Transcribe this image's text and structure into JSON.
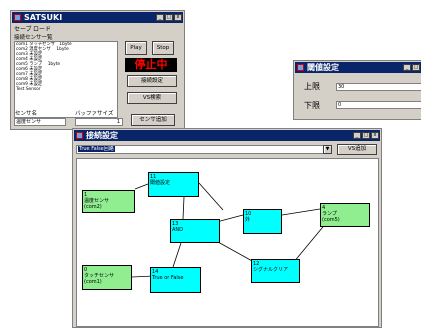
{
  "main_window": {
    "title": "SATSUKI",
    "menu": [
      "セーブ",
      "ロード"
    ],
    "list_label": "接続センサ一覧",
    "sensors": [
      "com1  タッチセンサ　1byte",
      "com2  温度センサ　 1byte",
      "com3       未設定",
      "com4       未設定",
      "com5  ランプ　 1byte",
      "com6       未設定",
      "com7       未設定",
      "com8       未設定",
      "com9       未設定",
      "        Test Sensor"
    ],
    "play_label": "Play",
    "stop_label": "Stop",
    "status_text": "停止中",
    "connect_settings_label": "接続設定",
    "vs_monitor_label": "VS検索",
    "sensor_name_label": "センサ名",
    "buffer_size_label": "バッファサイズ",
    "sensor_name_value": "温度センサ",
    "buffer_size_value": "1",
    "add_sensor_label": "センサ追加"
  },
  "threshold_window": {
    "title": "閾値設定",
    "upper_label": "上限",
    "upper_value": "30",
    "lower_label": "下限",
    "lower_value": "0"
  },
  "connection_window": {
    "title": "接続設定",
    "dropdown_value": "True False回路",
    "add_vs_label": "VS追加",
    "nodes": [
      {
        "id": "n1",
        "number": "1",
        "label": "温度センサ",
        "sub": "(com2)",
        "color": "#90ee90"
      },
      {
        "id": "n11",
        "number": "11",
        "label": "閾値設定",
        "sub": "",
        "color": "#00ffff"
      },
      {
        "id": "n13",
        "number": "13",
        "label": "AND",
        "sub": "",
        "color": "#00ffff"
      },
      {
        "id": "n10",
        "number": "10",
        "label": "外",
        "sub": "",
        "color": "#00ffff"
      },
      {
        "id": "n4",
        "number": "4",
        "label": "ランプ",
        "sub": "(com5)",
        "color": "#90ee90"
      },
      {
        "id": "n12",
        "number": "12",
        "label": "シグナルクリア",
        "sub": "",
        "color": "#00ffff"
      },
      {
        "id": "n0",
        "number": "0",
        "label": "タッチセンサ",
        "sub": "(com1)",
        "color": "#90ee90"
      },
      {
        "id": "n14",
        "number": "14",
        "label": "True or False",
        "sub": "",
        "color": "#00ffff"
      }
    ]
  },
  "colors": {
    "titlebar": "#0a246a",
    "status_red": "#ff0000",
    "node_process": "#00ffff",
    "node_io": "#90ee90"
  }
}
